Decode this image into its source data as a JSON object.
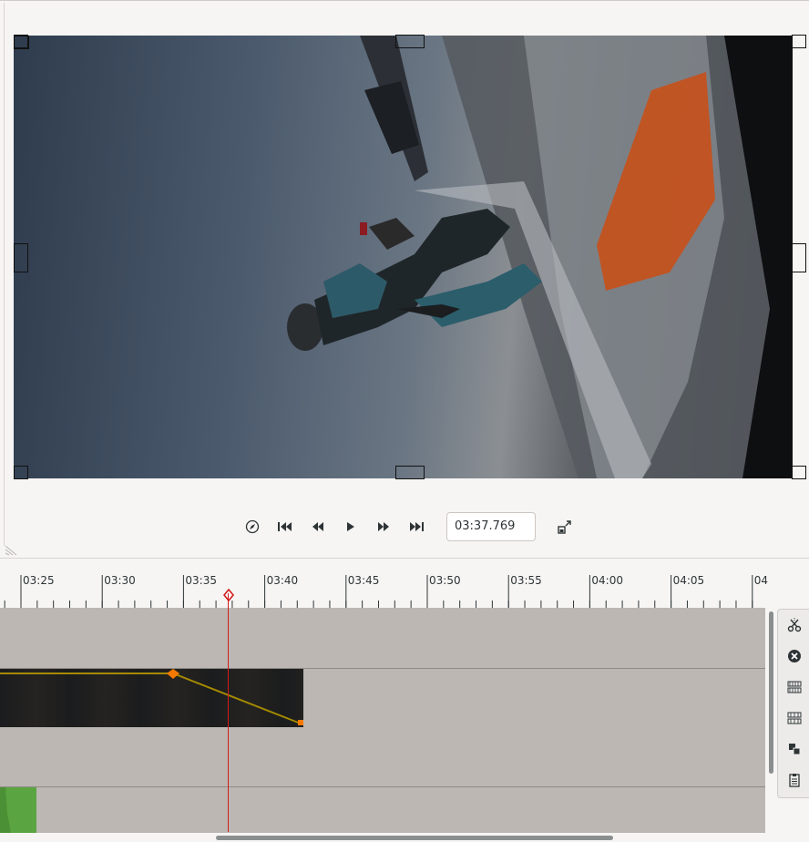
{
  "viewer": {
    "timecode": "03:37.769"
  },
  "transport": {
    "icons": [
      "compass-icon",
      "skip-start-icon",
      "rewind-icon",
      "play-icon",
      "fast-forward-icon",
      "skip-end-icon",
      "undock-icon"
    ]
  },
  "ruler": {
    "labels": [
      "03:25",
      "03:30",
      "03:35",
      "03:40",
      "03:45",
      "03:50",
      "03:55",
      "04:00",
      "04:05",
      "04"
    ]
  },
  "side_tools": {
    "icons": [
      "scissors-icon",
      "delete-icon",
      "ungroup-icon",
      "group-icon",
      "align-icon",
      "paste-icon"
    ]
  },
  "colors": {
    "playhead": "#d11b1b",
    "keyframe": "#f57900",
    "keyframe_line": "#a58a00",
    "audio_clip": "#5aa541",
    "track_bg": "#bcb7b2"
  }
}
